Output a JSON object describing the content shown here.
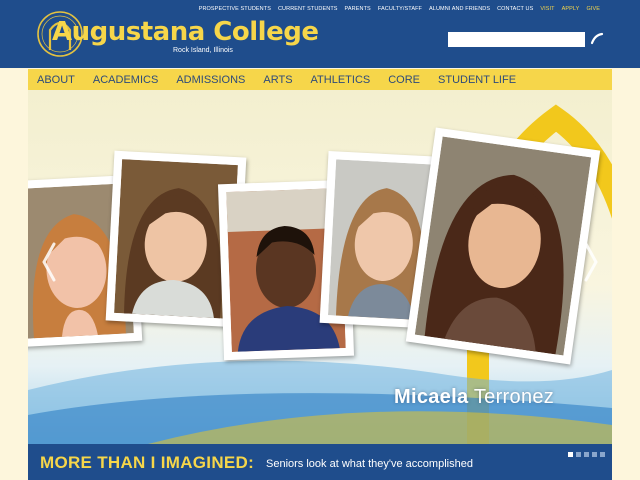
{
  "brand": {
    "name": "Augustana College",
    "location": "Rock Island, Illinois",
    "colors": {
      "blue": "#1f4d8c",
      "gold": "#f6d64a",
      "cream": "#fdf6dc"
    }
  },
  "top_links": [
    {
      "label": "PROSPECTIVE STUDENTS",
      "accent": false
    },
    {
      "label": "CURRENT STUDENTS",
      "accent": false
    },
    {
      "label": "PARENTS",
      "accent": false
    },
    {
      "label": "FACULTY/STAFF",
      "accent": false
    },
    {
      "label": "ALUMNI AND FRIENDS",
      "accent": false
    },
    {
      "label": "CONTACT US",
      "accent": false
    },
    {
      "label": "VISIT",
      "accent": true
    },
    {
      "label": "APPLY",
      "accent": true
    },
    {
      "label": "GIVE",
      "accent": true
    }
  ],
  "search": {
    "value": "",
    "placeholder": "",
    "icon": "search-icon"
  },
  "nav": [
    "ABOUT",
    "ACADEMICS",
    "ADMISSIONS",
    "ARTS",
    "ATHLETICS",
    "CORE",
    "STUDENT LIFE"
  ],
  "hero": {
    "caption_first": "Micaela",
    "caption_last": "Terronez",
    "prev_icon": "chevron-left-icon",
    "next_icon": "chevron-right-icon"
  },
  "banner": {
    "tagline": "MORE THAN I IMAGINED:",
    "subtitle": "Seniors look at what they've accomplished",
    "slide_count": 5,
    "active_slide": 1
  }
}
